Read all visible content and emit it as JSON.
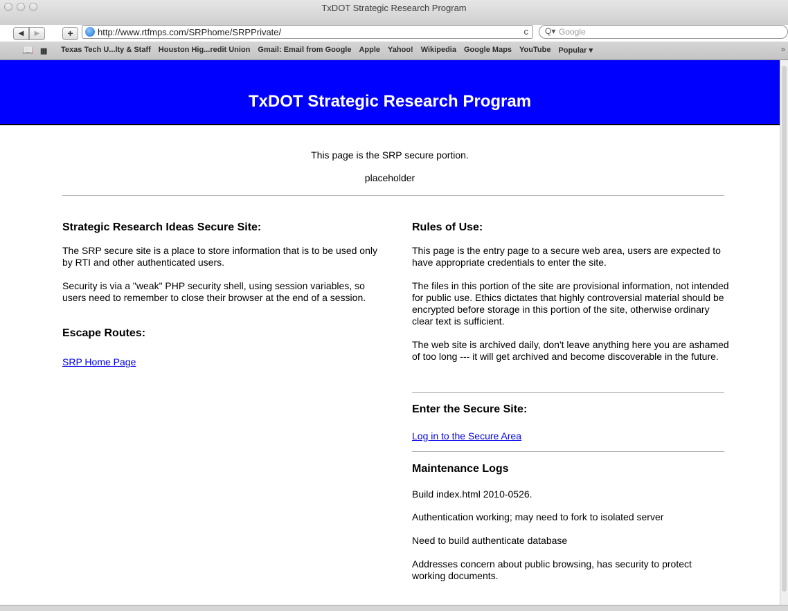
{
  "window": {
    "title": "TxDOT Strategic Research Program"
  },
  "toolbar": {
    "back_icon": "◀",
    "forward_icon": "▶",
    "add_label": "+",
    "url": "http://www.rtfmps.com/SRPhome/SRPPrivate/",
    "reload_icon": "c",
    "search_icon": "Q▾",
    "search_placeholder": "Google"
  },
  "bookmarks": {
    "items": [
      "Texas Tech U...lty & Staff",
      "Houston Hig...redit Union",
      "Gmail: Email from Google",
      "Apple",
      "Yahoo!",
      "Wikipedia",
      "Google Maps",
      "YouTube",
      "Popular ▾"
    ],
    "overflow_label": "»"
  },
  "page": {
    "banner_title": "TxDOT Strategic Research Program",
    "intro": "This page is the SRP secure portion.",
    "placeholder": "placeholder",
    "left": {
      "heading": "Strategic Research Ideas Secure Site:",
      "p1": "The SRP secure site is a place to store information that is to be used only by RTI and other authenticated users.",
      "p2": "Security is via a \"weak\" PHP security shell, using session variables, so users need to remember to close their browser at the end of a session.",
      "escape_heading": "Escape Routes:",
      "home_link": "SRP Home Page"
    },
    "right": {
      "rules_heading": "Rules of Use:",
      "rules_p1": "This page is the entry page to a secure web area, users are expected to have appropriate credentials to enter the site.",
      "rules_p2": "The files in this portion of the site are provisional information, not intended for public use. Ethics dictates that highly controversial material should be encrypted before storage in this portion of the site, otherwise ordinary clear text is sufficient.",
      "rules_p3": "The web site is archived daily, don't leave anything here you are ashamed of too long --- it will get archived and become discoverable in the future.",
      "enter_heading": "Enter the Secure Site:",
      "login_link": "Log in to the Secure Area",
      "maint_heading": "Maintenance Logs",
      "logs": [
        "Build index.html 2010-0526.",
        "Authentication working; may need to fork to isolated server",
        "Need to build authenticate database",
        "Addresses concern about public browsing, has security to protect working documents."
      ]
    }
  }
}
